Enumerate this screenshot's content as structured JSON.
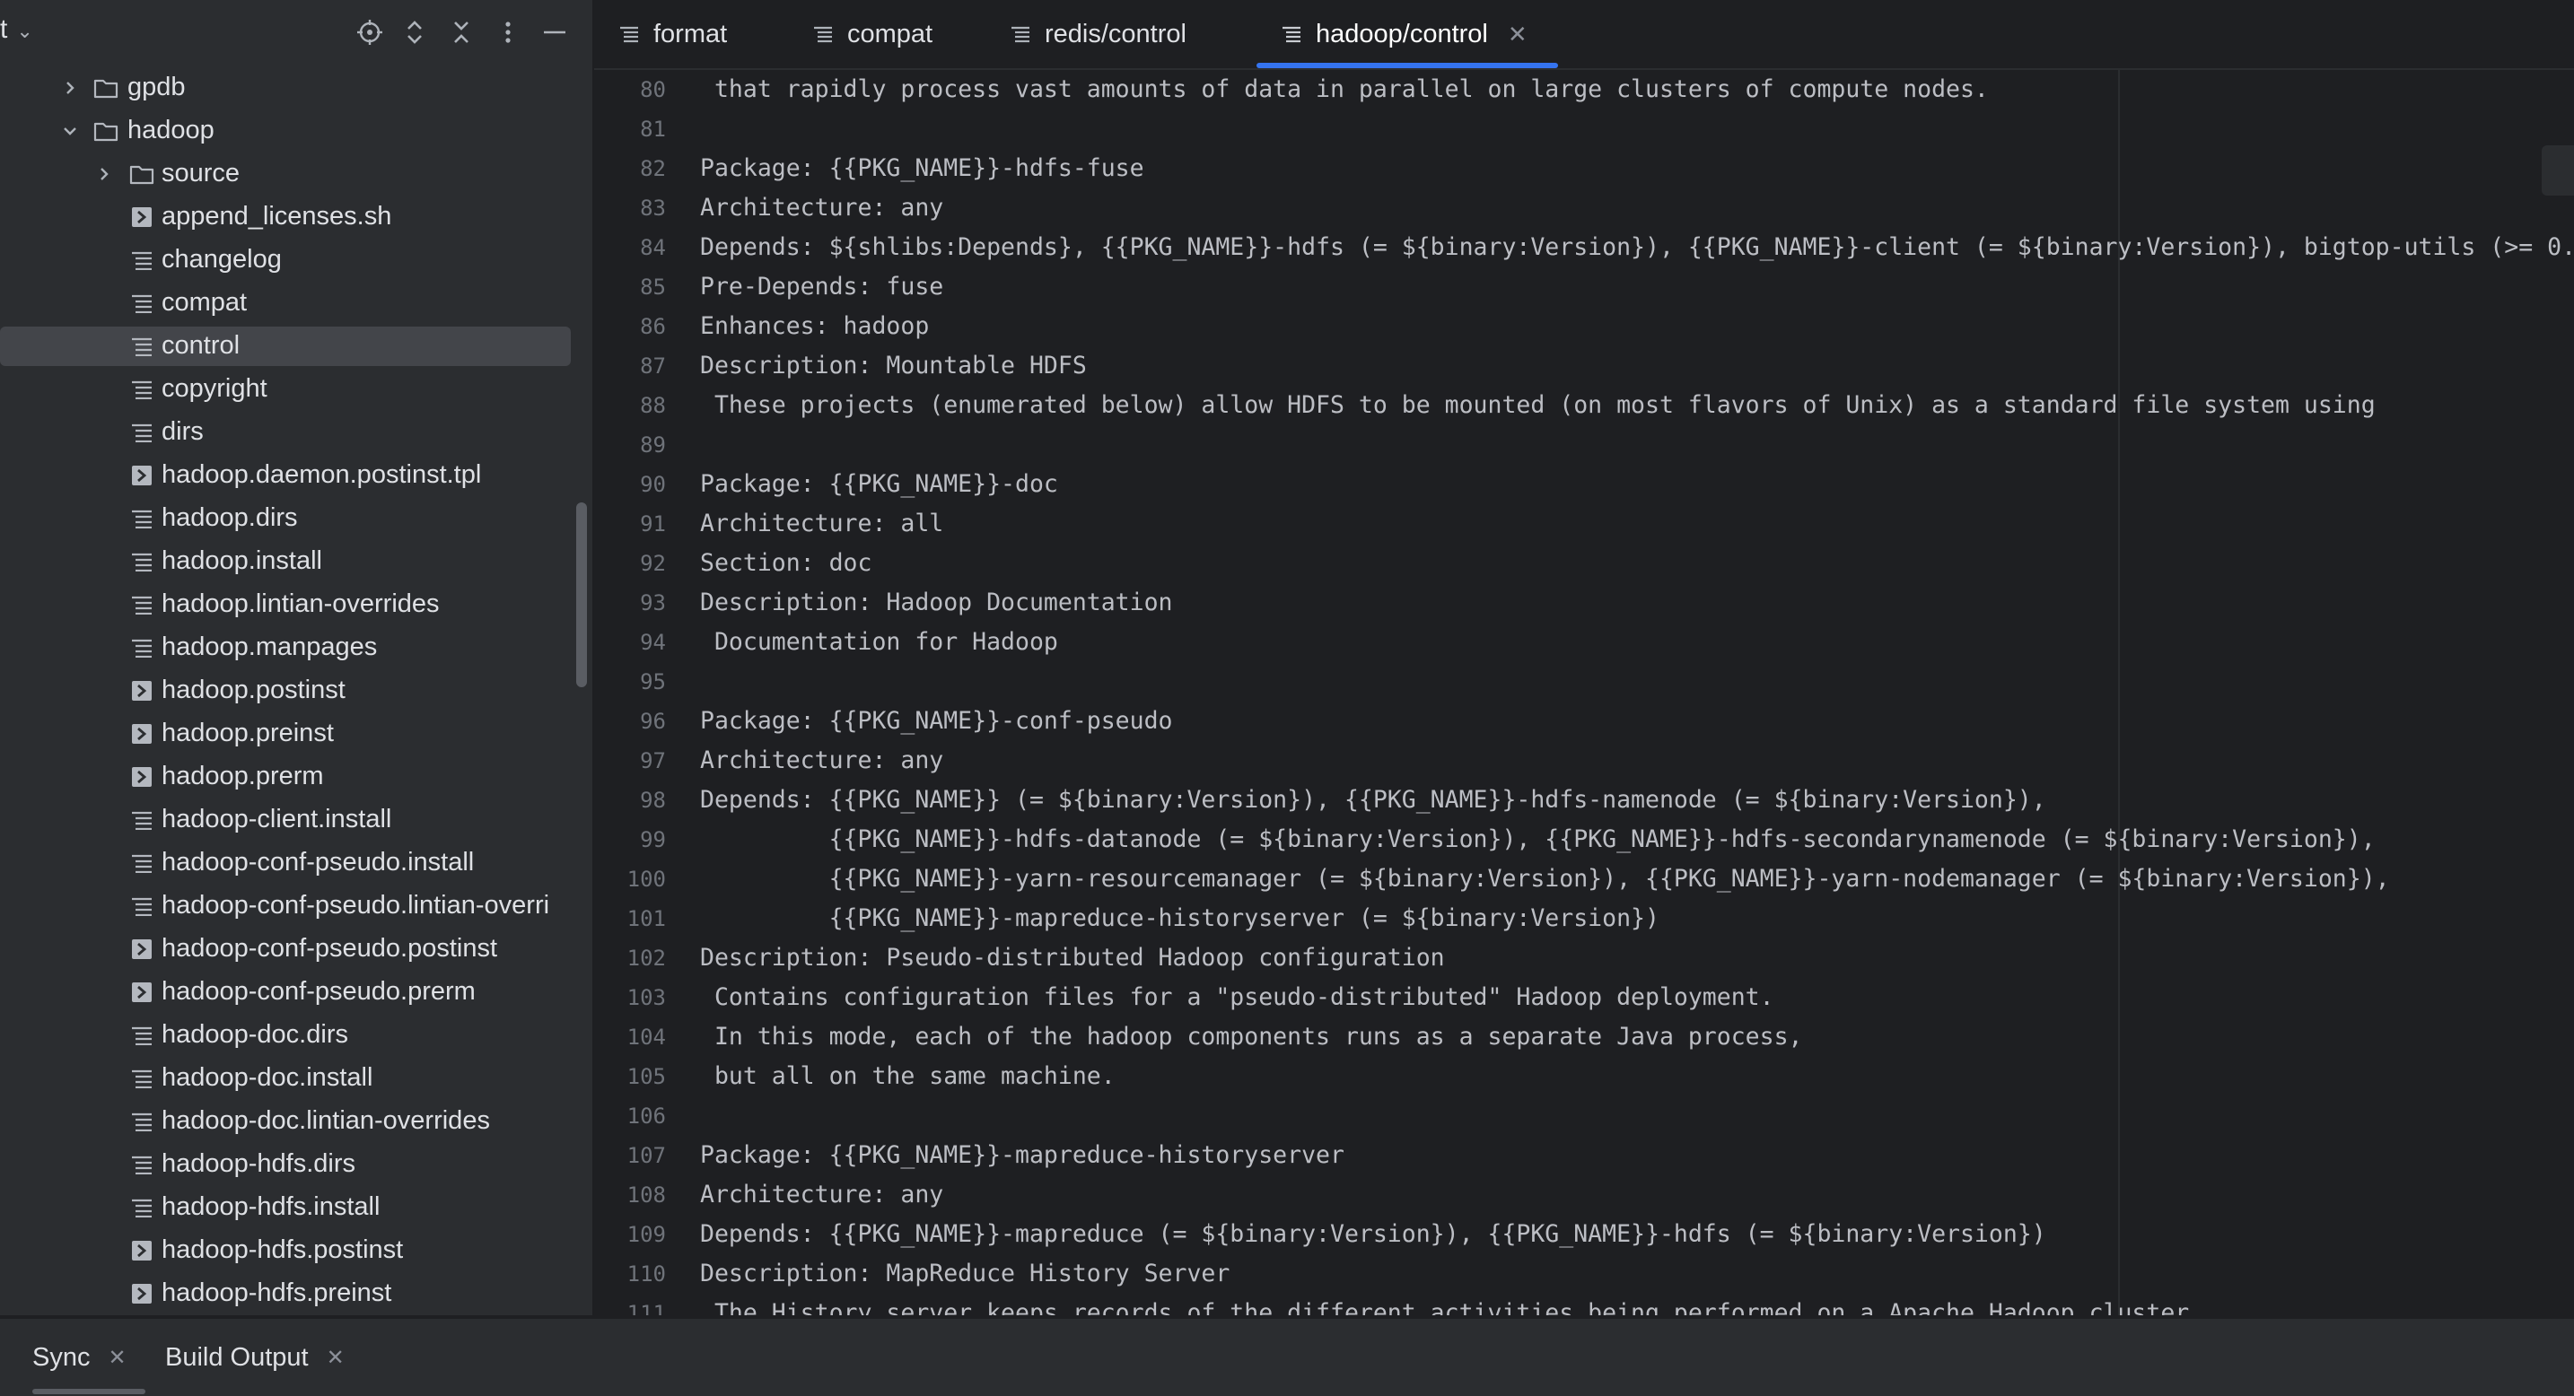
{
  "sidebar": {
    "title": "t",
    "tree": [
      {
        "label": "gpdb",
        "kind": "folder",
        "expand": "collapsed",
        "indent": 1
      },
      {
        "label": "hadoop",
        "kind": "folder",
        "expand": "expanded",
        "indent": 1
      },
      {
        "label": "source",
        "kind": "folder",
        "expand": "collapsed",
        "indent": 2
      },
      {
        "label": "append_licenses.sh",
        "kind": "exec",
        "indent": 2
      },
      {
        "label": "changelog",
        "kind": "text",
        "indent": 2
      },
      {
        "label": "compat",
        "kind": "text",
        "indent": 2
      },
      {
        "label": "control",
        "kind": "text",
        "indent": 2,
        "selected": true
      },
      {
        "label": "copyright",
        "kind": "text",
        "indent": 2
      },
      {
        "label": "dirs",
        "kind": "text",
        "indent": 2
      },
      {
        "label": "hadoop.daemon.postinst.tpl",
        "kind": "exec",
        "indent": 2
      },
      {
        "label": "hadoop.dirs",
        "kind": "text",
        "indent": 2
      },
      {
        "label": "hadoop.install",
        "kind": "text",
        "indent": 2
      },
      {
        "label": "hadoop.lintian-overrides",
        "kind": "text",
        "indent": 2
      },
      {
        "label": "hadoop.manpages",
        "kind": "text",
        "indent": 2
      },
      {
        "label": "hadoop.postinst",
        "kind": "exec",
        "indent": 2
      },
      {
        "label": "hadoop.preinst",
        "kind": "exec",
        "indent": 2
      },
      {
        "label": "hadoop.prerm",
        "kind": "exec",
        "indent": 2
      },
      {
        "label": "hadoop-client.install",
        "kind": "text",
        "indent": 2
      },
      {
        "label": "hadoop-conf-pseudo.install",
        "kind": "text",
        "indent": 2
      },
      {
        "label": "hadoop-conf-pseudo.lintian-overri",
        "kind": "text",
        "indent": 2
      },
      {
        "label": "hadoop-conf-pseudo.postinst",
        "kind": "exec",
        "indent": 2
      },
      {
        "label": "hadoop-conf-pseudo.prerm",
        "kind": "exec",
        "indent": 2
      },
      {
        "label": "hadoop-doc.dirs",
        "kind": "text",
        "indent": 2
      },
      {
        "label": "hadoop-doc.install",
        "kind": "text",
        "indent": 2
      },
      {
        "label": "hadoop-doc.lintian-overrides",
        "kind": "text",
        "indent": 2
      },
      {
        "label": "hadoop-hdfs.dirs",
        "kind": "text",
        "indent": 2
      },
      {
        "label": "hadoop-hdfs.install",
        "kind": "text",
        "indent": 2
      },
      {
        "label": "hadoop-hdfs.postinst",
        "kind": "exec",
        "indent": 2
      },
      {
        "label": "hadoop-hdfs.preinst",
        "kind": "exec",
        "indent": 2
      }
    ]
  },
  "tabs": [
    {
      "label": "format",
      "active": false
    },
    {
      "label": "compat",
      "active": false
    },
    {
      "label": "redis/control",
      "active": false
    },
    {
      "label": "hadoop/control",
      "active": true,
      "closable": true
    }
  ],
  "editor": {
    "lines": [
      {
        "n": "80",
        "t": " that rapidly process vast amounts of data in parallel on large clusters of compute nodes."
      },
      {
        "n": "81",
        "t": ""
      },
      {
        "n": "82",
        "t": "Package: {{PKG_NAME}}-hdfs-fuse"
      },
      {
        "n": "83",
        "t": "Architecture: any"
      },
      {
        "n": "84",
        "t": "Depends: ${shlibs:Depends}, {{PKG_NAME}}-hdfs (= ${binary:Version}), {{PKG_NAME}}-client (= ${binary:Version}), bigtop-utils (>= 0."
      },
      {
        "n": "85",
        "t": "Pre-Depends: fuse"
      },
      {
        "n": "86",
        "t": "Enhances: hadoop"
      },
      {
        "n": "87",
        "t": "Description: Mountable HDFS"
      },
      {
        "n": "88",
        "t": " These projects (enumerated below) allow HDFS to be mounted (on most flavors of Unix) as a standard file system using"
      },
      {
        "n": "89",
        "t": ""
      },
      {
        "n": "90",
        "t": "Package: {{PKG_NAME}}-doc"
      },
      {
        "n": "91",
        "t": "Architecture: all"
      },
      {
        "n": "92",
        "t": "Section: doc"
      },
      {
        "n": "93",
        "t": "Description: Hadoop Documentation"
      },
      {
        "n": "94",
        "t": " Documentation for Hadoop"
      },
      {
        "n": "95",
        "t": ""
      },
      {
        "n": "96",
        "t": "Package: {{PKG_NAME}}-conf-pseudo"
      },
      {
        "n": "97",
        "t": "Architecture: any"
      },
      {
        "n": "98",
        "t": "Depends: {{PKG_NAME}} (= ${binary:Version}), {{PKG_NAME}}-hdfs-namenode (= ${binary:Version}),"
      },
      {
        "n": "99",
        "t": "         {{PKG_NAME}}-hdfs-datanode (= ${binary:Version}), {{PKG_NAME}}-hdfs-secondarynamenode (= ${binary:Version}),"
      },
      {
        "n": "100",
        "t": "         {{PKG_NAME}}-yarn-resourcemanager (= ${binary:Version}), {{PKG_NAME}}-yarn-nodemanager (= ${binary:Version}),"
      },
      {
        "n": "101",
        "t": "         {{PKG_NAME}}-mapreduce-historyserver (= ${binary:Version})"
      },
      {
        "n": "102",
        "t": "Description: Pseudo-distributed Hadoop configuration"
      },
      {
        "n": "103",
        "t": " Contains configuration files for a \"pseudo-distributed\" Hadoop deployment."
      },
      {
        "n": "104",
        "t": " In this mode, each of the hadoop components runs as a separate Java process,"
      },
      {
        "n": "105",
        "t": " but all on the same machine."
      },
      {
        "n": "106",
        "t": ""
      },
      {
        "n": "107",
        "t": "Package: {{PKG_NAME}}-mapreduce-historyserver"
      },
      {
        "n": "108",
        "t": "Architecture: any"
      },
      {
        "n": "109",
        "t": "Depends: {{PKG_NAME}}-mapreduce (= ${binary:Version}), {{PKG_NAME}}-hdfs (= ${binary:Version})"
      },
      {
        "n": "110",
        "t": "Description: MapReduce History Server"
      },
      {
        "n": "111",
        "t": " The History server keeps records of the different activities being performed on a Apache Hadoop cluster"
      }
    ]
  },
  "bottom": {
    "tabs": [
      {
        "label": "Sync"
      },
      {
        "label": "Build Output"
      }
    ]
  },
  "colors": {
    "accent": "#3574f0",
    "background": "#1e1f22",
    "panel": "#2b2d30",
    "selection": "#43454a"
  }
}
